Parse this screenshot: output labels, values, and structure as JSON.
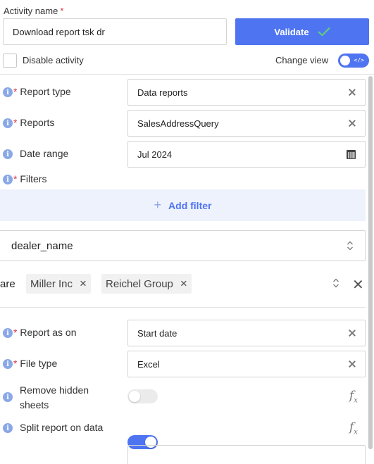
{
  "header": {
    "activity_name_label": "Activity name",
    "required_mark": "*",
    "activity_name_value": "Download report tsk dr",
    "validate_label": "Validate",
    "disable_activity_label": "Disable activity",
    "disable_activity_checked": false,
    "change_view_label": "Change view",
    "change_view_on": true,
    "change_view_icon": "</>"
  },
  "form": {
    "report_type": {
      "label": "Report type",
      "required": true,
      "value": "Data reports"
    },
    "reports": {
      "label": "Reports",
      "required": true,
      "value": "SalesAddressQuery"
    },
    "date_range": {
      "label": "Date range",
      "required": false,
      "value": "Jul 2024"
    },
    "filters": {
      "label": "Filters",
      "required": true,
      "add_filter_label": "Add filter"
    },
    "filter_row": {
      "field": "dealer_name",
      "operator_fragment": "are",
      "values": [
        "Miller Inc",
        "Reichel Group"
      ]
    },
    "report_as_on": {
      "label": "Report as on",
      "required": true,
      "value": "Start date"
    },
    "file_type": {
      "label": "File type",
      "required": true,
      "value": "Excel"
    },
    "remove_hidden_sheets": {
      "label_line1": "Remove hidden",
      "label_line2": "sheets",
      "on": false
    },
    "split_report": {
      "label": "Split report on data",
      "on": true
    }
  },
  "icons": {
    "info": "i",
    "fx": "f",
    "fx_sub": "x",
    "plus": "+",
    "chip_close": "×",
    "clear": "✕"
  },
  "colors": {
    "accent": "#4f74f1",
    "required": "#e0343f",
    "info": "#8aa8e6",
    "add_filter_bg": "#eef2fc"
  }
}
